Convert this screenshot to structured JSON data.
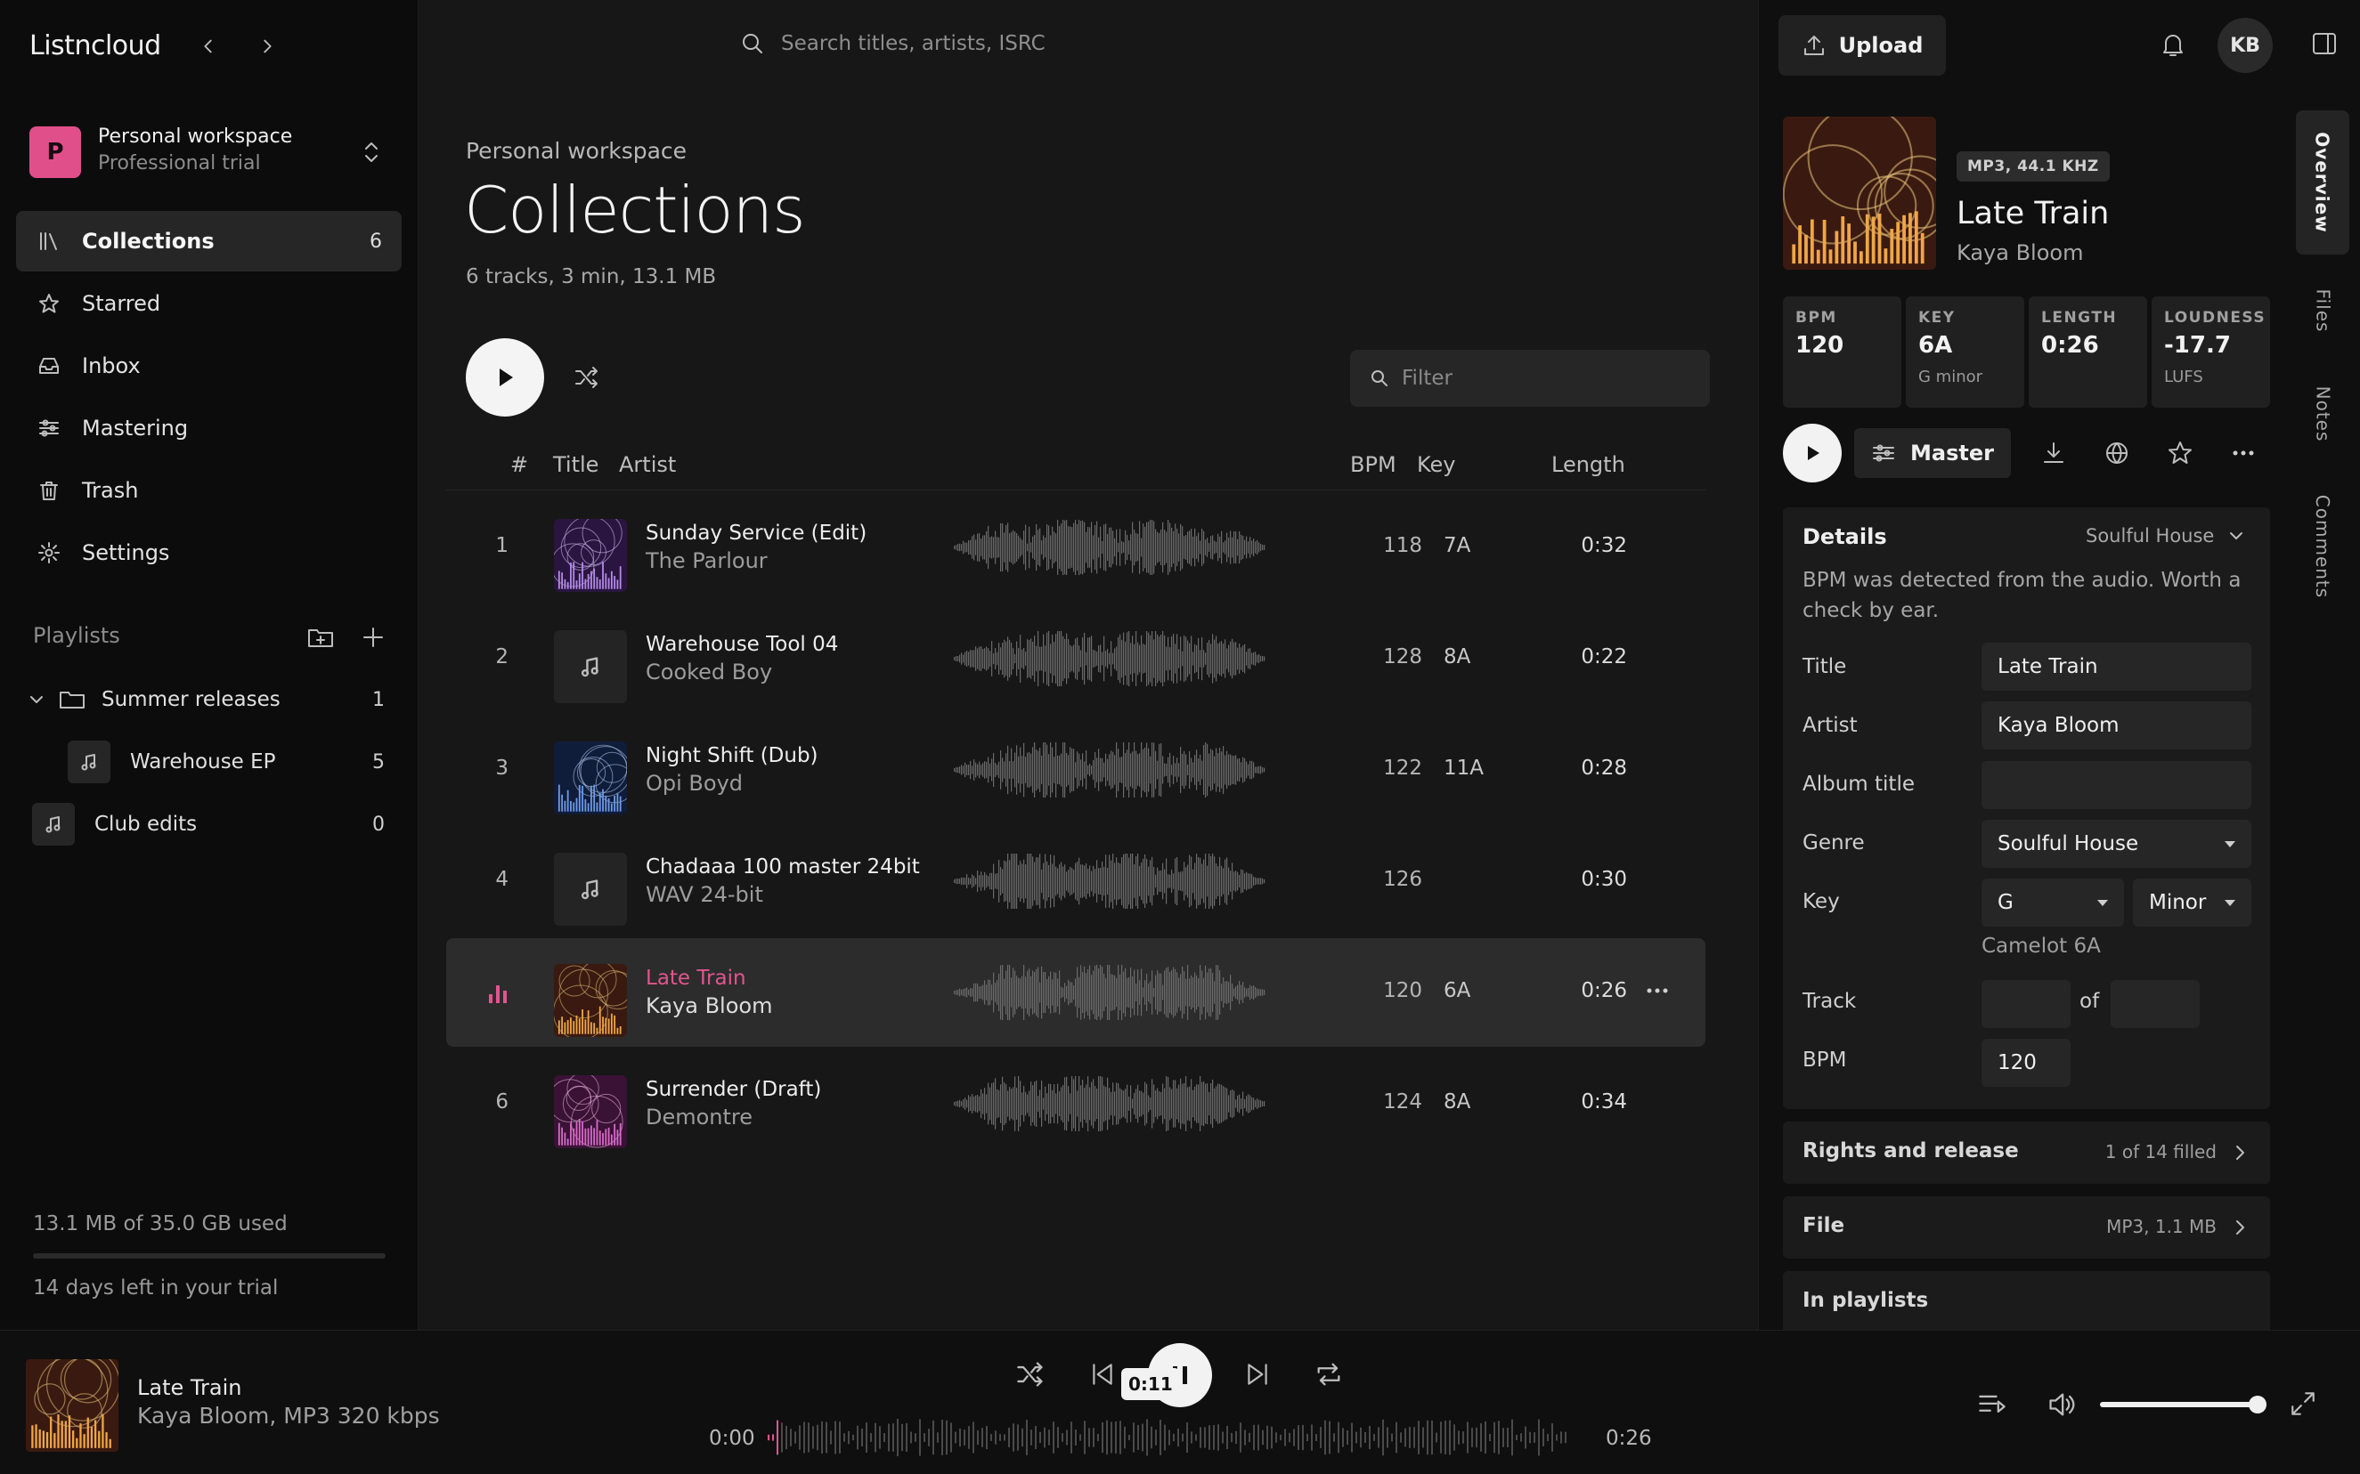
{
  "app": {
    "name": "Listncloud"
  },
  "workspace": {
    "name": "Personal workspace",
    "plan": "Professional trial",
    "initial": "P"
  },
  "nav": [
    {
      "label": "Collections",
      "count": "6",
      "icon": "library-icon",
      "active": true
    },
    {
      "label": "Starred",
      "icon": "star-icon"
    },
    {
      "label": "Inbox",
      "icon": "inbox-icon"
    },
    {
      "label": "Mastering",
      "icon": "sliders-icon"
    },
    {
      "label": "Trash",
      "icon": "trash-icon"
    },
    {
      "label": "Settings",
      "icon": "gear-icon"
    }
  ],
  "playlists": {
    "heading": "Playlists",
    "folder": {
      "label": "Summer releases",
      "count": "1"
    },
    "items": [
      {
        "label": "Warehouse EP",
        "count": "5"
      },
      {
        "label": "Club edits",
        "count": "0"
      }
    ]
  },
  "storage": {
    "used_text": "13.1 MB of 35.0 GB used",
    "fraction": 0.0004,
    "trial_text": "14 days left in your trial"
  },
  "search": {
    "placeholder": "Search titles, artists, ISRC"
  },
  "page": {
    "breadcrumb": "Personal workspace",
    "title": "Collections",
    "summary": "6 tracks, 3 min, 13.1 MB",
    "filter_placeholder": "Filter"
  },
  "table": {
    "headers": {
      "num": "#",
      "title": "Title",
      "artist": "Artist",
      "bpm": "BPM",
      "key": "Key",
      "length": "Length"
    },
    "rows": [
      {
        "num": "1",
        "title": "Sunday Service (Edit)",
        "artist": "The Parlour",
        "bpm": "118",
        "key": "7A",
        "length": "0:32",
        "art": "purple"
      },
      {
        "num": "2",
        "title": "Warehouse Tool 04",
        "artist": "Cooked Boy",
        "bpm": "128",
        "key": "8A",
        "length": "0:22",
        "art": "note"
      },
      {
        "num": "3",
        "title": "Night Shift (Dub)",
        "artist": "Opi Boyd",
        "bpm": "122",
        "key": "11A",
        "length": "0:28",
        "art": "blue"
      },
      {
        "num": "4",
        "title": "Chadaaa 100 master 24bit",
        "artist": "WAV 24-bit",
        "bpm": "126",
        "key": "",
        "length": "0:30",
        "art": "note"
      },
      {
        "num": "",
        "title": "Late Train",
        "artist": "Kaya Bloom",
        "bpm": "120",
        "key": "6A",
        "length": "0:26",
        "art": "orange",
        "playing": true
      },
      {
        "num": "6",
        "title": "Surrender (Draft)",
        "artist": "Demontre",
        "bpm": "124",
        "key": "8A",
        "length": "0:34",
        "art": "magenta"
      }
    ]
  },
  "panel": {
    "upload_label": "Upload",
    "avatar_initials": "KB",
    "tabs": [
      "Overview",
      "Files",
      "Notes",
      "Comments"
    ],
    "format_badge": "MP3, 44.1 KHZ",
    "title": "Late Train",
    "artist": "Kaya Bloom",
    "stats": [
      {
        "label": "BPM",
        "value": "120",
        "sub": ""
      },
      {
        "label": "KEY",
        "value": "6A",
        "sub": "G minor"
      },
      {
        "label": "LENGTH",
        "value": "0:26",
        "sub": ""
      },
      {
        "label": "LOUDNESS",
        "value": "-17.7",
        "sub": "LUFS"
      }
    ],
    "master_label": "Master",
    "details": {
      "heading": "Details",
      "genre_tag": "Soulful House",
      "note": "BPM was detected from the audio. Worth a check by ear.",
      "title_label": "Title",
      "title_value": "Late Train",
      "artist_label": "Artist",
      "artist_value": "Kaya Bloom",
      "album_label": "Album title",
      "album_value": "",
      "genre_label": "Genre",
      "genre_value": "Soulful House",
      "key_label": "Key",
      "key_value": "G",
      "mode_value": "Minor",
      "camelot": "Camelot 6A",
      "track_label": "Track",
      "track_of": "of",
      "track_value": "",
      "track_total": "",
      "bpm_label": "BPM",
      "bpm_value": "120"
    },
    "rights": {
      "label": "Rights and release",
      "status": "1 of 14 filled"
    },
    "file": {
      "label": "File",
      "status": "MP3, 1.1 MB"
    },
    "in_playlists": {
      "label": "In playlists"
    }
  },
  "player": {
    "title": "Late Train",
    "subtitle": "Kaya Bloom, MP3 320 kbps",
    "current": "0:00",
    "position": "0:11",
    "duration": "0:26",
    "volume": 0.95
  },
  "colors": {
    "accent": "#e1558e",
    "background": "#161616",
    "sidebar": "#0c0c0c"
  }
}
